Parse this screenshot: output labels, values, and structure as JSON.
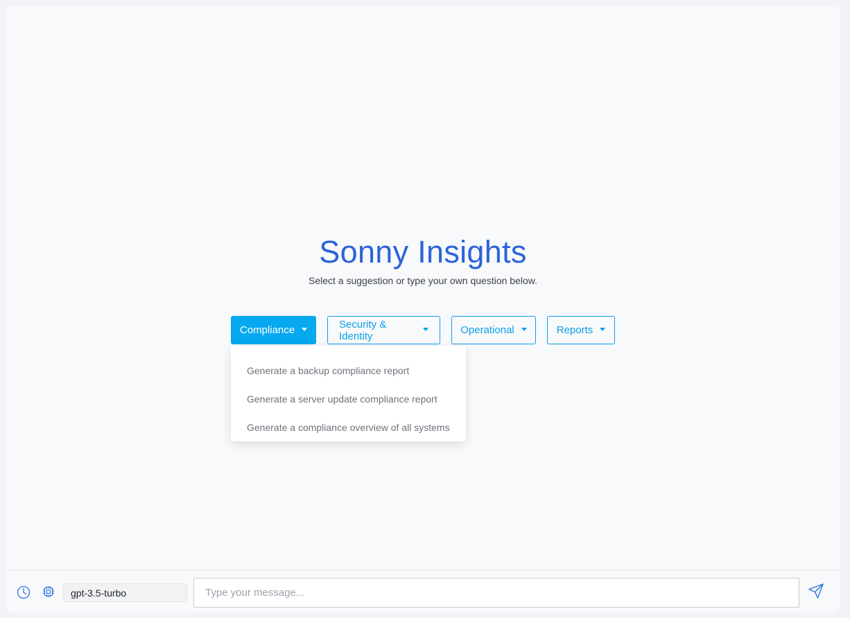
{
  "main": {
    "title": "Sonny Insights",
    "subtitle": "Select a suggestion or type your own question below."
  },
  "categories": [
    {
      "label": "Compliance",
      "active": true
    },
    {
      "label": "Security & Identity",
      "active": false
    },
    {
      "label": "Operational",
      "active": false
    },
    {
      "label": "Reports",
      "active": false
    }
  ],
  "dropdown": {
    "items": [
      "Generate a backup compliance report",
      "Generate a server update compliance report",
      "Generate a compliance overview of all systems"
    ]
  },
  "footer": {
    "history_icon": "clock-icon",
    "model_icon": "chip-icon",
    "model": "gpt-3.5-turbo",
    "input_placeholder": "Type your message...",
    "send_icon": "send-icon"
  },
  "colors": {
    "title": "#2b63d9",
    "accent": "#06a8f0",
    "background": "#f8f9fb"
  }
}
